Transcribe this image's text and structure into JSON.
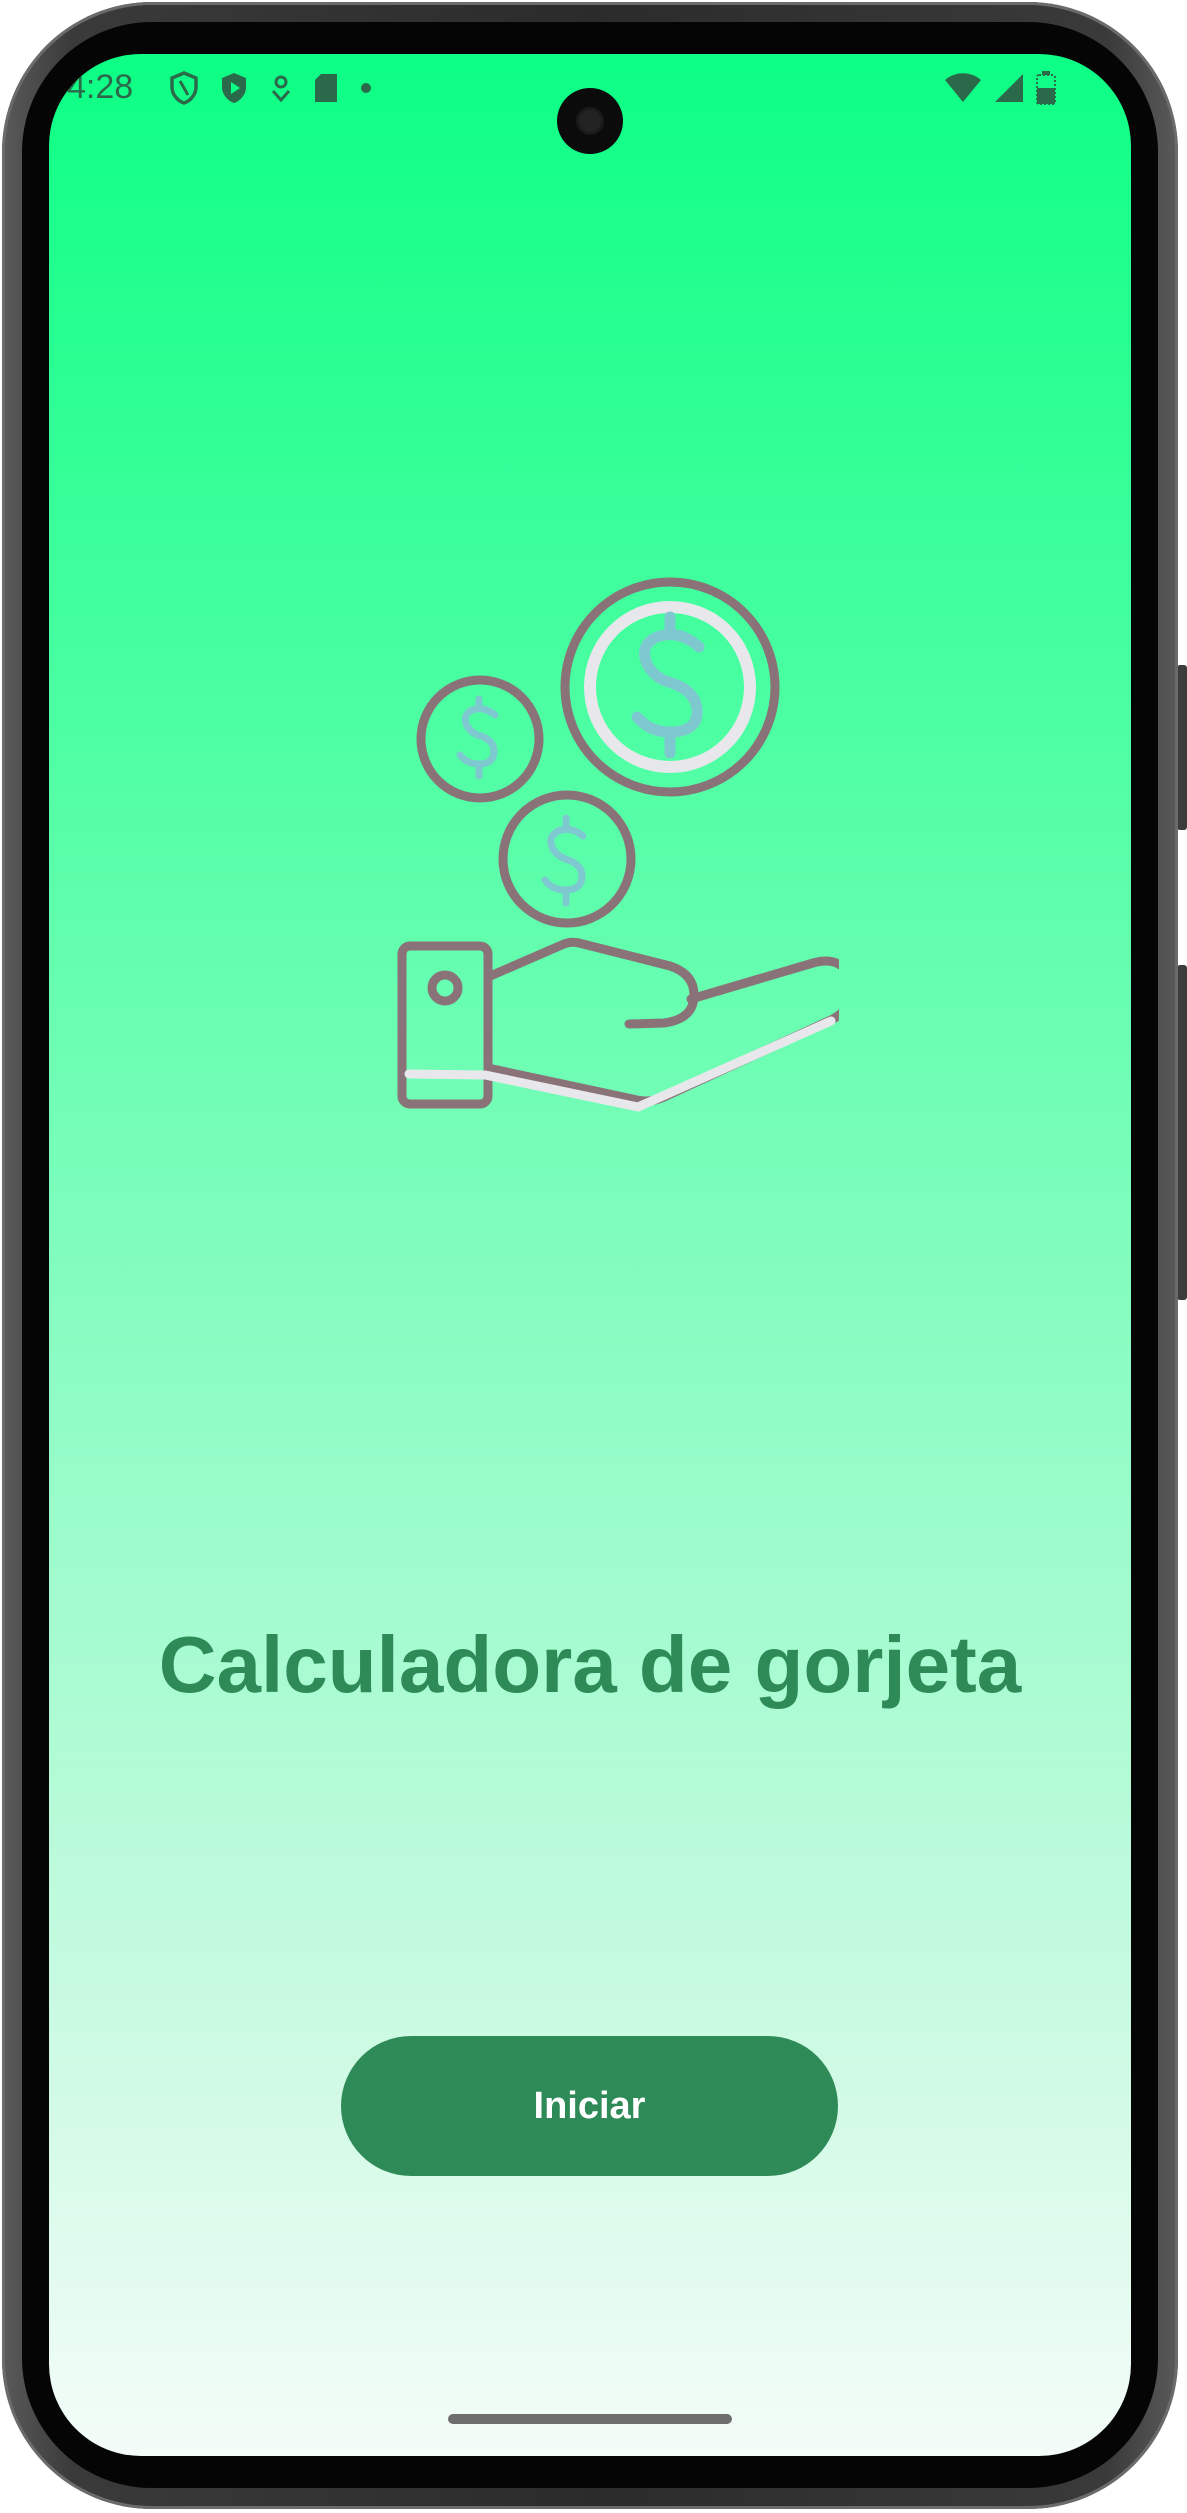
{
  "status_bar": {
    "time": "4:28",
    "left_icons": [
      "shield-outline-icon",
      "shield-play-icon",
      "location-pin-icon",
      "sd-card-icon",
      "notification-dot-icon"
    ],
    "right_icons": [
      "wifi-icon",
      "cell-signal-icon",
      "battery-icon"
    ]
  },
  "illustration": {
    "name": "hand-with-coins-icon",
    "stroke_color": "#8a7378",
    "symbol_color": "#7ec8d0",
    "highlight_color": "#e8e8ec"
  },
  "main": {
    "title": "Calculadora de gorjeta",
    "start_button_label": "Iniciar"
  },
  "colors": {
    "gradient_top": "#0dff85",
    "gradient_bottom": "#f4fcf8",
    "accent": "#2e8b57"
  }
}
